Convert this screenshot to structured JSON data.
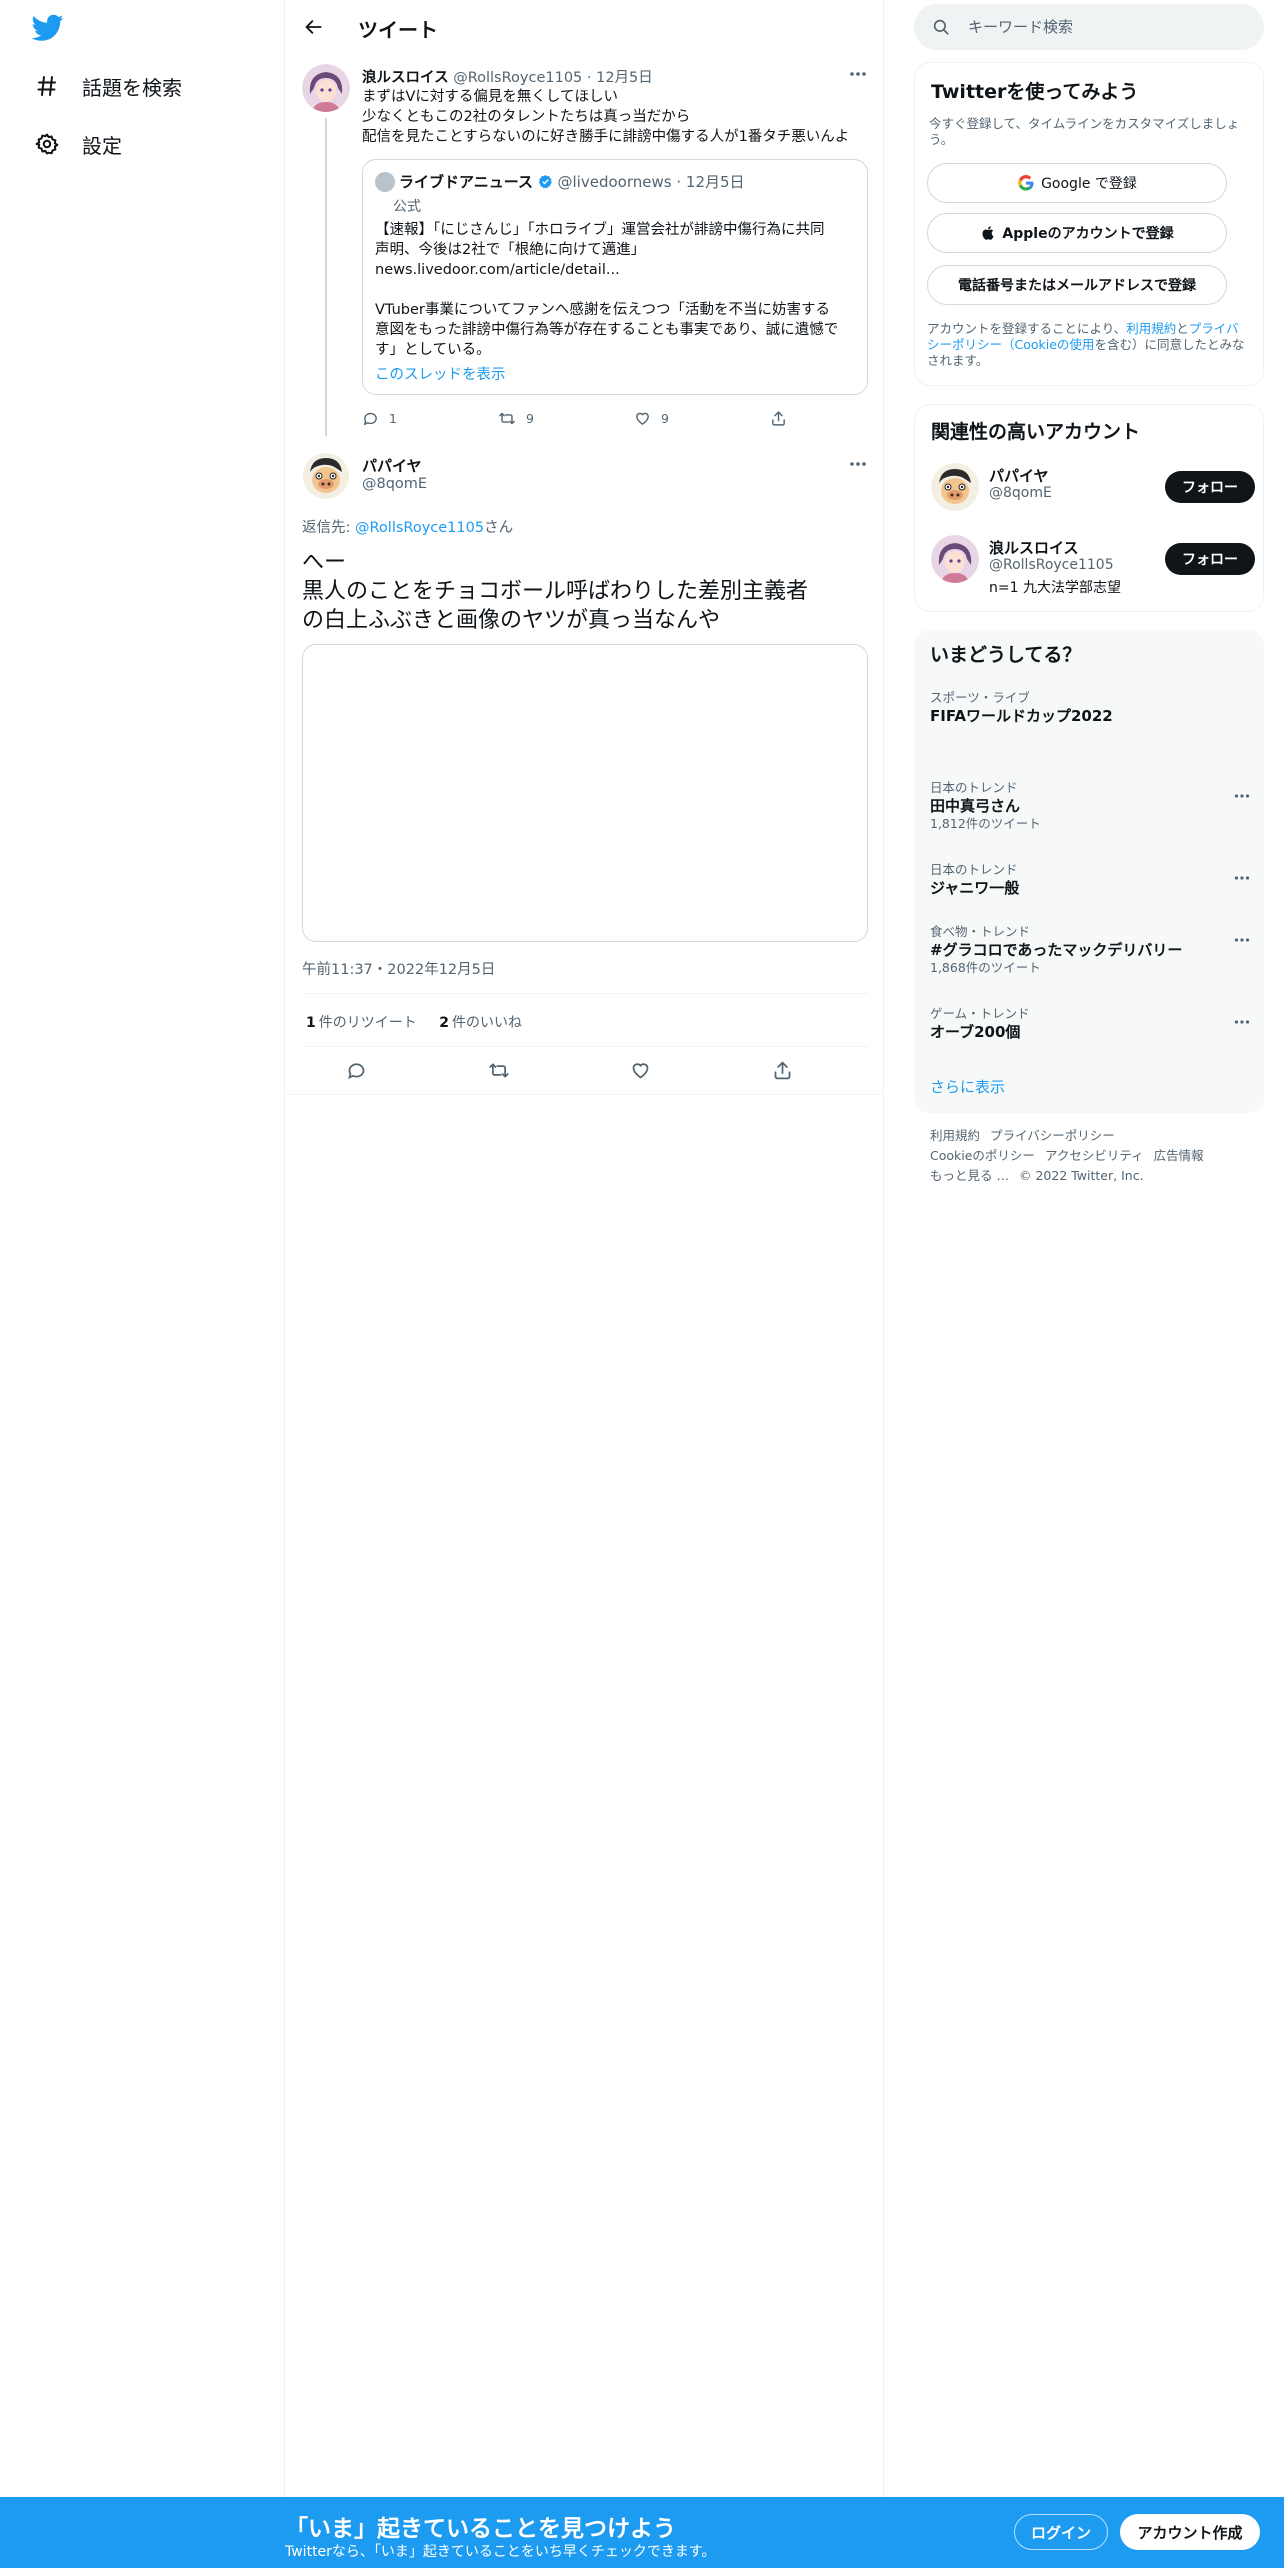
{
  "colors": {
    "brand": "#1d9bf0",
    "text": "#0f1419",
    "muted": "#536471",
    "border": "#eff3f4"
  },
  "nav": {
    "logo_icon": "twitter-bird-icon",
    "items": [
      {
        "icon": "hashtag-icon",
        "label": "話題を検索"
      },
      {
        "icon": "gear-icon",
        "label": "設定"
      }
    ]
  },
  "header": {
    "back_icon": "arrow-left-icon",
    "title": "ツイート"
  },
  "parent_tweet": {
    "name": "浪ルスロイス",
    "handle": "@RollsRoyce1105",
    "date": "12月5日",
    "lines": [
      "まずはVに対する偏見を無くしてほしい",
      "少なくともこの2社のタレントたちは真っ当だから",
      "配信を見たことすらないのに好き勝手に誹謗中傷する人が1番タチ悪いんよ"
    ],
    "quote": {
      "name": "ライブドアニュース",
      "handle": "@livedoornews",
      "date": "12月5日",
      "official": "公式",
      "lines": [
        "【速報】「にじさんじ」「ホロライブ」運営会社が誹謗中傷行為に共同",
        "声明、今後は2社で「根絶に向けて邁進」",
        "news.livedoor.com/article/detail...",
        "",
        "VTuber事業についてファンへ感謝を伝えつつ「活動を不当に妨害する",
        "意図をもった誹謗中傷行為等が存在することも事実であり、誠に遺憾で",
        "す」としている。"
      ],
      "show_thread": "このスレッドを表示"
    },
    "actions": {
      "replies": "1",
      "retweets": "9",
      "likes": "9"
    }
  },
  "main_tweet": {
    "name": "パパイヤ",
    "handle": "@8qomE",
    "reply_prefix": "返信先: ",
    "reply_handle": "@RollsRoyce1105",
    "reply_suffix": "さん",
    "lines": [
      "へー",
      "黒人のことをチョコボール呼ばわりした差別主義者",
      "の白上ふぶきと画像のヤツが真っ当なんや"
    ],
    "timestamp": "午前11:37・2022年12月5日",
    "retweet_count": "1",
    "retweet_label": "件のリツイート",
    "like_count": "2",
    "like_label": "件のいいね"
  },
  "sidebar": {
    "search_placeholder": "キーワード検索",
    "signup": {
      "title": "Twitterを使ってみよう",
      "subtitle": "今すぐ登録して、タイムラインをカスタマイズしましょう。",
      "google": "Google で登録",
      "apple": "Appleのアカウントで登録",
      "phone": "電話番号またはメールアドレスで登録",
      "terms_1": "アカウントを登録することにより、",
      "terms_link1": "利用規約",
      "terms_2": "と",
      "terms_link2": "プライバシーポリシー（Cookieの使用",
      "terms_3": "を含む）に同意したとみなされます。"
    },
    "related": {
      "title": "関連性の高いアカウント",
      "accounts": [
        {
          "name": "パパイヤ",
          "handle": "@8qomE",
          "bio": "",
          "follow": "フォロー"
        },
        {
          "name": "浪ルスロイス",
          "handle": "@RollsRoyce1105",
          "bio": "n=1 九大法学部志望",
          "follow": "フォロー"
        }
      ]
    },
    "trends": {
      "title": "いまどうしてる？",
      "items": [
        {
          "category": "スポーツ・ライブ",
          "title": "FIFAワールドカップ2022",
          "count": ""
        },
        {
          "category": "日本のトレンド",
          "title": "田中真弓さん",
          "count": "1,812件のツイート"
        },
        {
          "category": "日本のトレンド",
          "title": "ジャニワ一般",
          "count": ""
        },
        {
          "category": "食べ物・トレンド",
          "title": "#グラコロであったマックデリバリー",
          "count": "1,868件のツイート"
        },
        {
          "category": "ゲーム・トレンド",
          "title": "オーブ200個",
          "count": ""
        }
      ],
      "show_more": "さらに表示"
    },
    "footer": {
      "links": [
        "利用規約",
        "プライバシーポリシー",
        "Cookieのポリシー",
        "アクセシビリティ",
        "広告情報",
        "もっと見る …"
      ],
      "copyright": "© 2022 Twitter, Inc."
    }
  },
  "bottom_bar": {
    "title": "「いま」起きていることを見つけよう",
    "subtitle": "Twitterなら、「いま」起きていることをいち早くチェックできます。",
    "login": "ログイン",
    "signup": "アカウント作成"
  }
}
